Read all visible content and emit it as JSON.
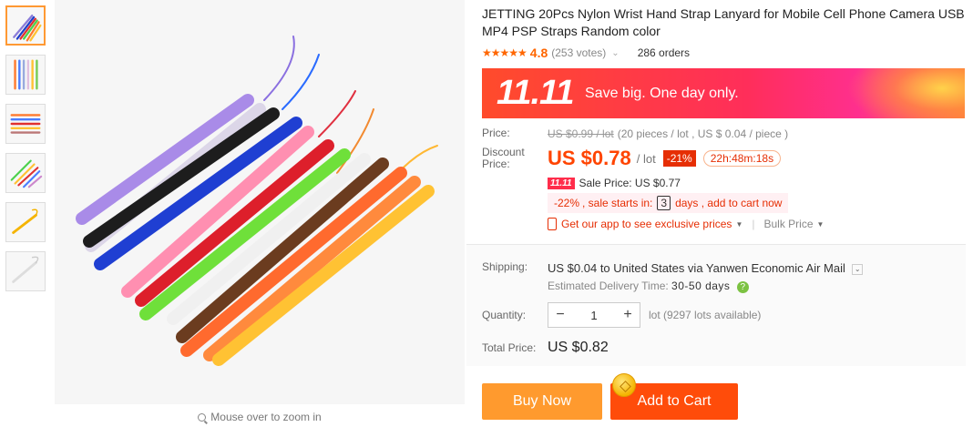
{
  "product": {
    "title": "JETTING 20Pcs Nylon Wrist Hand Strap Lanyard for Mobile Cell Phone Camera USB MP4 PSP Straps Random color",
    "rating": "4.8",
    "stars": 5,
    "votes": "(253 votes)",
    "orders": "286 orders"
  },
  "gallery": {
    "zoom_hint": "Mouse over to zoom in",
    "thumb_count": 6
  },
  "banner": {
    "event": "11.11",
    "tagline": "Save big. One day only."
  },
  "pricing": {
    "price_label": "Price:",
    "old_price": "US $0.99 / lot",
    "pieces_info": "(20 pieces / lot , US $ 0.04 / piece )",
    "discount_label": "Discount Price:",
    "discount_price": "US $0.78",
    "per_lot": "/ lot",
    "discount_pct": "-21%",
    "timer": "22h:48m:18s",
    "mini_badge": "11.11",
    "sale_price": "Sale Price: US $0.77",
    "sale_pct": "-22%",
    "sale_starts_prefix": ", sale starts in:",
    "sale_days": "3",
    "sale_starts_suffix": "days , add to cart now",
    "app_prices": "Get our app to see exclusive prices",
    "bulk_price": "Bulk Price"
  },
  "shipping": {
    "label": "Shipping:",
    "text": "US $0.04 to United States via Yanwen Economic Air Mail",
    "est_label": "Estimated Delivery Time:",
    "est_value": "30-50 days"
  },
  "quantity": {
    "label": "Quantity:",
    "value": "1",
    "minus": "−",
    "plus": "+",
    "available": "lot (9297 lots available)"
  },
  "total": {
    "label": "Total Price:",
    "value": "US $0.82"
  },
  "actions": {
    "buy_now": "Buy Now",
    "add_to_cart": "Add to Cart"
  },
  "colors": {
    "accent": "#ff4400",
    "buy_now": "#ff9a2e",
    "add_to_cart": "#ff4c0a",
    "rating": "#ff6600"
  }
}
